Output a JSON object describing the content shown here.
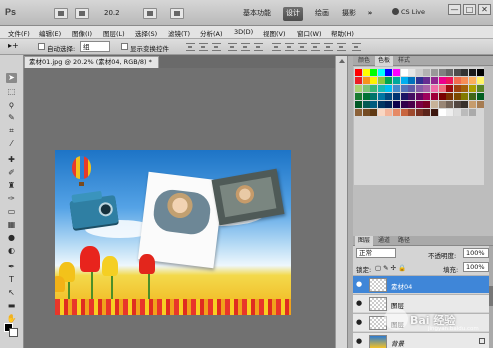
{
  "app": {
    "logo": "Ps",
    "zoom": "20.2",
    "workspace_buttons": [
      "基本功能",
      "设计",
      "绘画",
      "摄影"
    ],
    "active_workspace": "设计",
    "more": "»",
    "cs_live": "CS Live",
    "window_controls": [
      "—",
      "□",
      "✕"
    ]
  },
  "menu": [
    "文件(F)",
    "编辑(E)",
    "图像(I)",
    "图层(L)",
    "选择(S)",
    "滤镜(T)",
    "分析(A)",
    "3D(D)",
    "视图(V)",
    "窗口(W)",
    "帮助(H)"
  ],
  "options": {
    "auto_select_label": "自动选择:",
    "auto_select_value": "组",
    "show_transform_label": "显示变换控件"
  },
  "document": {
    "tab_title": "素材01.jpg @ 20.2% (素材04, RGB/8) *",
    "tab_close": "×"
  },
  "swatches_panel": {
    "tabs": [
      "颜色",
      "色板",
      "样式"
    ],
    "active_tab": "色板",
    "colors": [
      "#ff0000",
      "#ffff00",
      "#00ff00",
      "#00ffff",
      "#0000ff",
      "#ff00ff",
      "#ffffff",
      "#e6e6e6",
      "#cccccc",
      "#b3b3b3",
      "#999999",
      "#808080",
      "#666666",
      "#4d4d4d",
      "#333333",
      "#1a1a1a",
      "#000000",
      "#ed1c24",
      "#f7941d",
      "#fff200",
      "#8dc63f",
      "#00a651",
      "#00a99d",
      "#00aeef",
      "#0072bc",
      "#2e3192",
      "#662d91",
      "#92278f",
      "#ec008c",
      "#ed145b",
      "#f26c4f",
      "#f68e56",
      "#fbaf5d",
      "#fff568",
      "#acd373",
      "#7cc576",
      "#3bb878",
      "#1abbb4",
      "#00bff3",
      "#438ccb",
      "#5574b9",
      "#605ca8",
      "#855fa8",
      "#a763a8",
      "#f06ea9",
      "#f26d7d",
      "#9e0b0f",
      "#a0410d",
      "#a3620a",
      "#aba000",
      "#598527",
      "#1a7b30",
      "#007236",
      "#00746b",
      "#0076a3",
      "#004a80",
      "#003471",
      "#1b1464",
      "#440e62",
      "#630460",
      "#9e005d",
      "#9e0039",
      "#790000",
      "#7b2e00",
      "#7d4900",
      "#827b00",
      "#406618",
      "#005e20",
      "#005826",
      "#005952",
      "#005b7f",
      "#003663",
      "#002157",
      "#0d004c",
      "#32004b",
      "#4b0049",
      "#7b0046",
      "#7a0026",
      "#c7b299",
      "#998675",
      "#736357",
      "#534741",
      "#37302a",
      "#c69c6d",
      "#a67c52",
      "#8c6239",
      "#754c24",
      "#603913",
      "#f9d7c3",
      "#f4b59a",
      "#e58a66",
      "#c8653f",
      "#9e4a2e",
      "#793223",
      "#5b241a",
      "#3d170f",
      "#ffffff",
      "#eeeeee",
      "#dddddd",
      "#bbbbbb",
      "#aaaaaa"
    ]
  },
  "layers_panel": {
    "tabs": [
      "图层",
      "通道",
      "路径"
    ],
    "active_tab": "图层",
    "blend_mode": "正常",
    "opacity_label": "不透明度:",
    "opacity_value": "100%",
    "lock_label": "锁定:",
    "fill_label": "填充:",
    "fill_value": "100%",
    "layers": [
      {
        "name": "素材04",
        "selected": true
      },
      {
        "name": "图层",
        "selected": false
      },
      {
        "name": "图层",
        "selected": false
      },
      {
        "name": "背景",
        "selected": false
      }
    ]
  },
  "watermark": {
    "text": "Bai 经验",
    "sub": "jingyan.baidu.com"
  }
}
